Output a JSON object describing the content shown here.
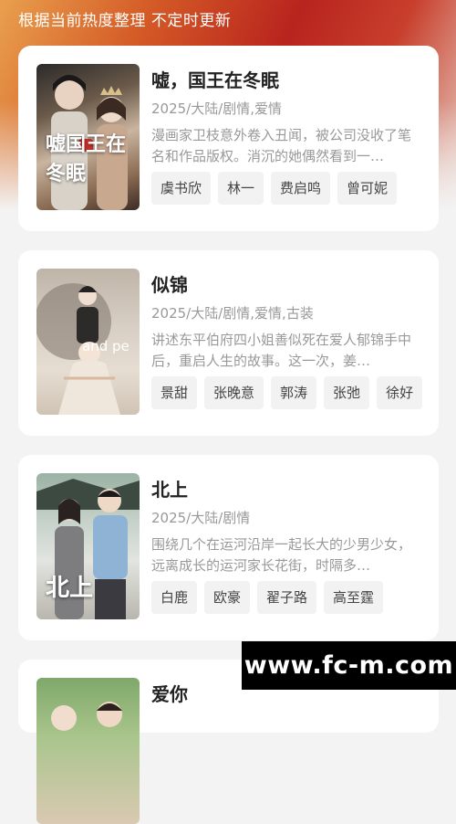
{
  "header": {
    "notice": "根据当前热度整理 不定时更新"
  },
  "items": [
    {
      "title": "嘘，国王在冬眠",
      "meta": "2025/大陆/剧情,爱情",
      "desc": "漫画家卫枝意外卷入丑闻，被公司没收了笔名和作品版权。消沉的她偶然看到一…",
      "tags": [
        "虞书欣",
        "林一",
        "费启鸣",
        "曾可妮"
      ],
      "poster_text": "嘘国王在冬眠"
    },
    {
      "title": "似锦",
      "meta": "2025/大陆/剧情,爱情,古装",
      "desc": "讲述东平伯府四小姐善似死在爱人郁锦手中后，重启人生的故事。这一次，姜…",
      "tags": [
        "景甜",
        "张晚意",
        "郭涛",
        "张弛",
        "徐好"
      ],
      "poster_text": "and pe"
    },
    {
      "title": "北上",
      "meta": "2025/大陆/剧情",
      "desc": "围绕几个在运河沿岸一起长大的少男少女，远离成长的运河家长花街，时隔多…",
      "tags": [
        "白鹿",
        "欧豪",
        "翟子路",
        "高至霆"
      ],
      "poster_text": "北上"
    },
    {
      "title": "爱你",
      "meta": "",
      "desc": "",
      "tags": [],
      "poster_text": ""
    }
  ],
  "watermark": "www.fc-m.com"
}
